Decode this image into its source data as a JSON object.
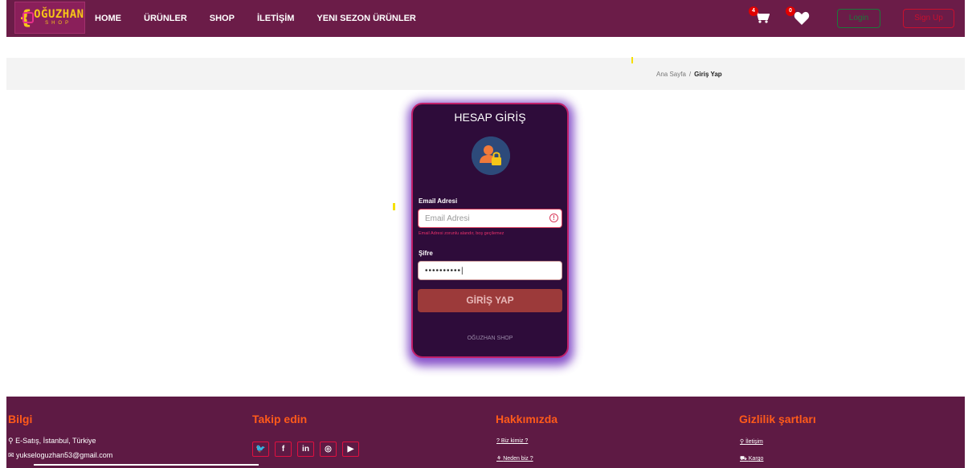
{
  "nav": {
    "logo": {
      "word": "OĞUZHAN",
      "sub": "SHOP"
    },
    "links": [
      "HOME",
      "ÜRÜNLER",
      "SHOP",
      "İLETİŞİM",
      "YENI SEZON ÜRÜNLER"
    ],
    "cart_count": "4",
    "wishlist_count": "0",
    "login_label": "Login",
    "signup_label": "Sign Up"
  },
  "breadcrumb": {
    "home": "Ana Sayfa",
    "separator": "/",
    "current": "Giriş Yap"
  },
  "login": {
    "title": "HESAP GİRİŞ",
    "email_label": "Email Adresi",
    "email_placeholder": "Email Adresi",
    "email_error": "Email Adresi zorunlu alandır, boş geçilemez",
    "password_label": "Şifre",
    "password_value": "••••••••••|",
    "submit_label": "GİRİŞ YAP",
    "footer_text": "OĞUZHAN SHOP"
  },
  "footer": {
    "info": {
      "title": "Bilgi",
      "address": "E-Satış, İstanbul, Türkiye",
      "email": "yukseloguzhan53@gmail.com"
    },
    "follow": {
      "title": "Takip edin",
      "icons": [
        "twitter-icon",
        "facebook-icon",
        "linkedin-icon",
        "instagram-icon",
        "youtube-icon"
      ]
    },
    "about": {
      "title": "Hakkımızda",
      "links": [
        "Biz kimiz ?",
        "Neden biz ?"
      ]
    },
    "privacy": {
      "title": "Gizlilik şartları",
      "links": [
        "İletişim",
        "Kargo"
      ]
    }
  },
  "colors": {
    "nav_bg": "#6b1c48",
    "card_bg": "#2e0c3a",
    "card_border": "#c0206a",
    "accent_orange": "#ff5a1a",
    "footer_bg": "#5e1a44"
  }
}
